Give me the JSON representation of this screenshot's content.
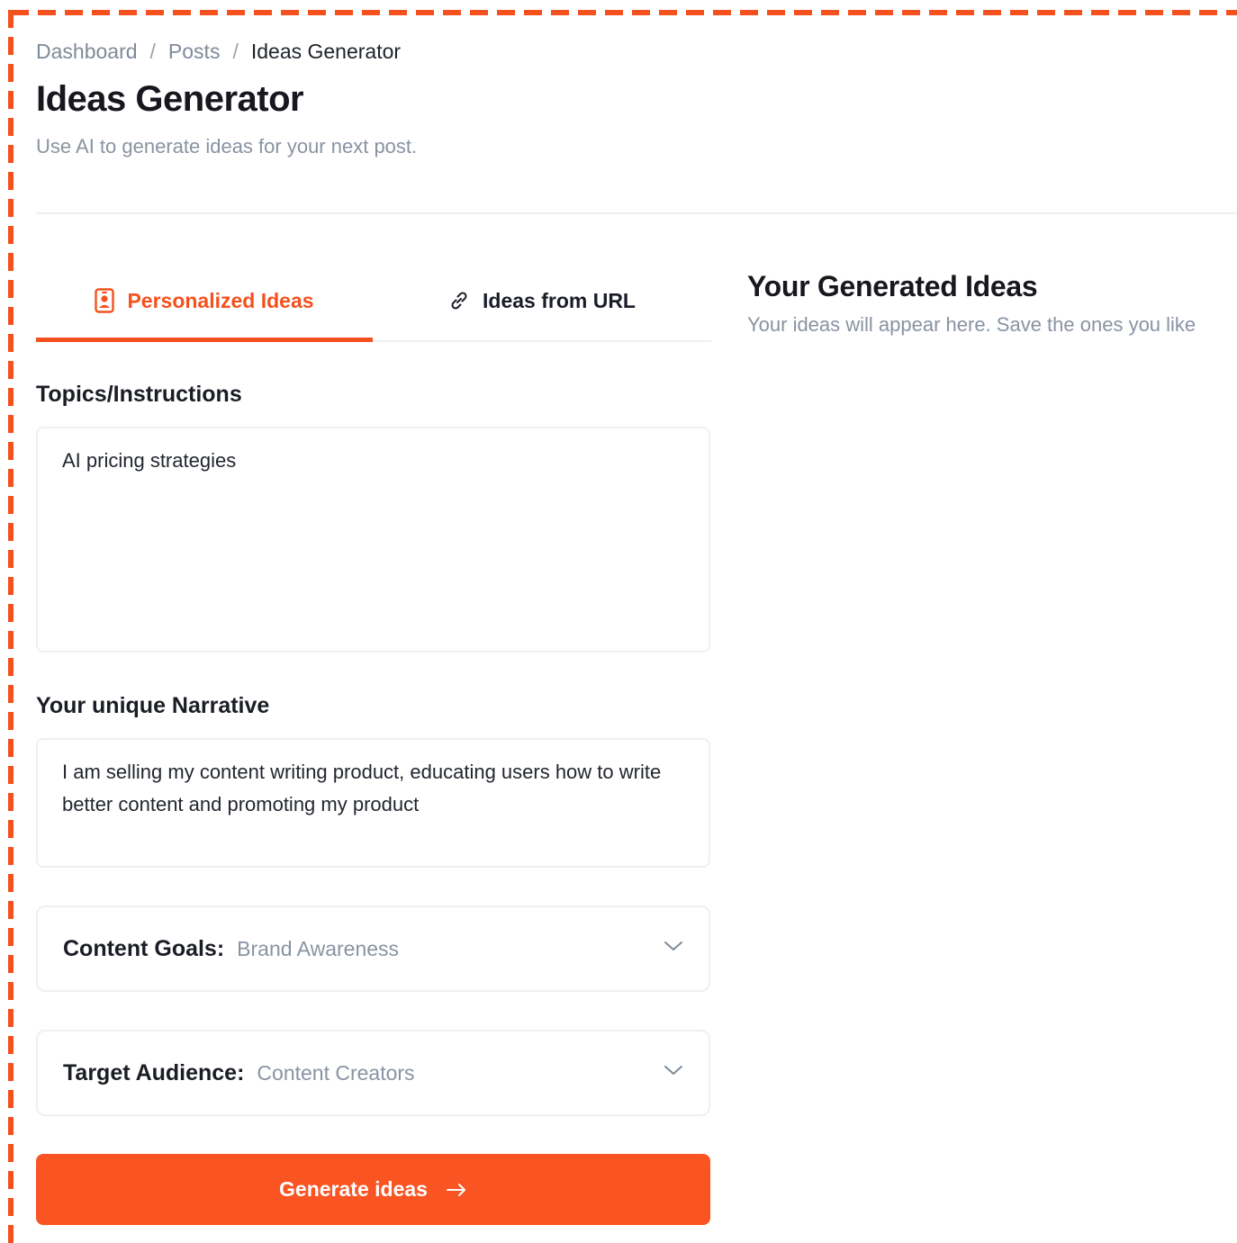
{
  "colors": {
    "accent": "#f4511e",
    "button": "#f95422",
    "text_dark": "#16181d",
    "text_muted": "#8993a3",
    "border": "#eef0f3"
  },
  "breadcrumb": {
    "items": [
      "Dashboard",
      "Posts",
      "Ideas Generator"
    ],
    "separator": "/"
  },
  "page": {
    "title": "Ideas Generator",
    "subtitle": "Use AI to generate ideas for your next post."
  },
  "tabs": [
    {
      "label": "Personalized Ideas",
      "icon": "user-badge-icon",
      "active": true
    },
    {
      "label": "Ideas from URL",
      "icon": "link-icon",
      "active": false
    }
  ],
  "form": {
    "topics": {
      "label": "Topics/Instructions",
      "value": "AI pricing strategies"
    },
    "narrative": {
      "label": "Your unique Narrative",
      "value": "I am selling my content writing product, educating users how to write better content and promoting my product"
    },
    "content_goals": {
      "label": "Content Goals:",
      "value": "Brand Awareness",
      "icon": "chevron-down-icon"
    },
    "target_audience": {
      "label": "Target Audience:",
      "value": "Content Creators",
      "icon": "chevron-down-icon"
    },
    "generate": {
      "label": "Generate ideas",
      "icon": "arrow-right-icon"
    }
  },
  "results": {
    "title": "Your Generated Ideas",
    "subtitle": "Your ideas will appear here. Save the ones you like"
  }
}
